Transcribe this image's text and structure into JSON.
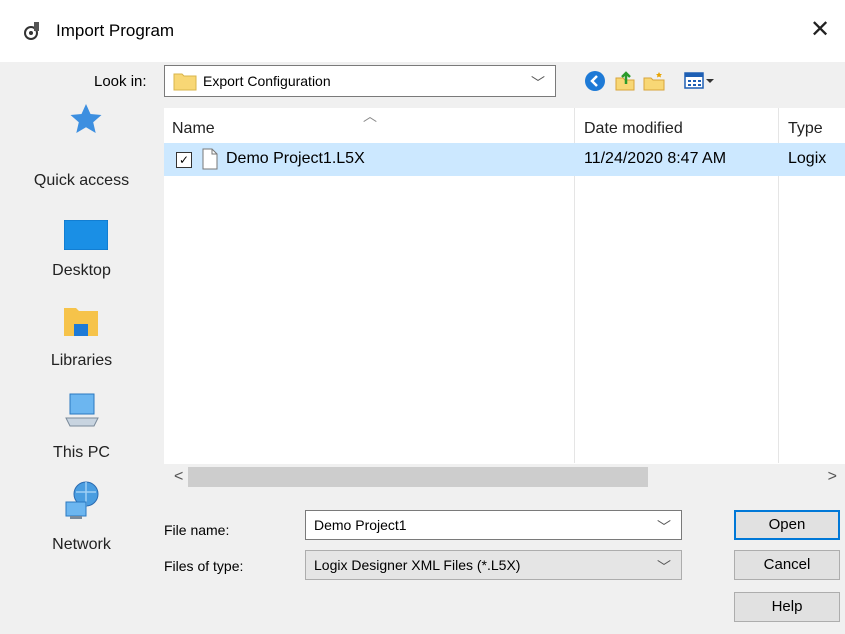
{
  "window": {
    "title": "Import Program",
    "close_glyph": "✕"
  },
  "lookin": {
    "label": "Look in:",
    "value": "Export Configuration"
  },
  "toolbar": {
    "icons": [
      "back-icon",
      "up-folder-icon",
      "new-folder-icon",
      "view-menu-icon"
    ]
  },
  "places": [
    {
      "label": "Quick access",
      "icon": "quick-access-icon"
    },
    {
      "label": "Desktop",
      "icon": "desktop-icon"
    },
    {
      "label": "Libraries",
      "icon": "libraries-icon"
    },
    {
      "label": "This PC",
      "icon": "this-pc-icon"
    },
    {
      "label": "Network",
      "icon": "network-icon"
    }
  ],
  "columns": {
    "name": "Name",
    "date": "Date modified",
    "type": "Type"
  },
  "files": [
    {
      "name": "Demo Project1.L5X",
      "date": "11/24/2020 8:47 AM",
      "type": "Logix",
      "checked": true
    }
  ],
  "scroll": {
    "left": "<",
    "right": ">"
  },
  "filename": {
    "label": "File name:",
    "value": "Demo Project1"
  },
  "filetype": {
    "label": "Files of type:",
    "value": "Logix Designer XML Files (*.L5X)"
  },
  "buttons": {
    "open": "Open",
    "cancel": "Cancel",
    "help": "Help"
  },
  "colors": {
    "selection": "#cce8ff",
    "accent": "#0078d7"
  }
}
